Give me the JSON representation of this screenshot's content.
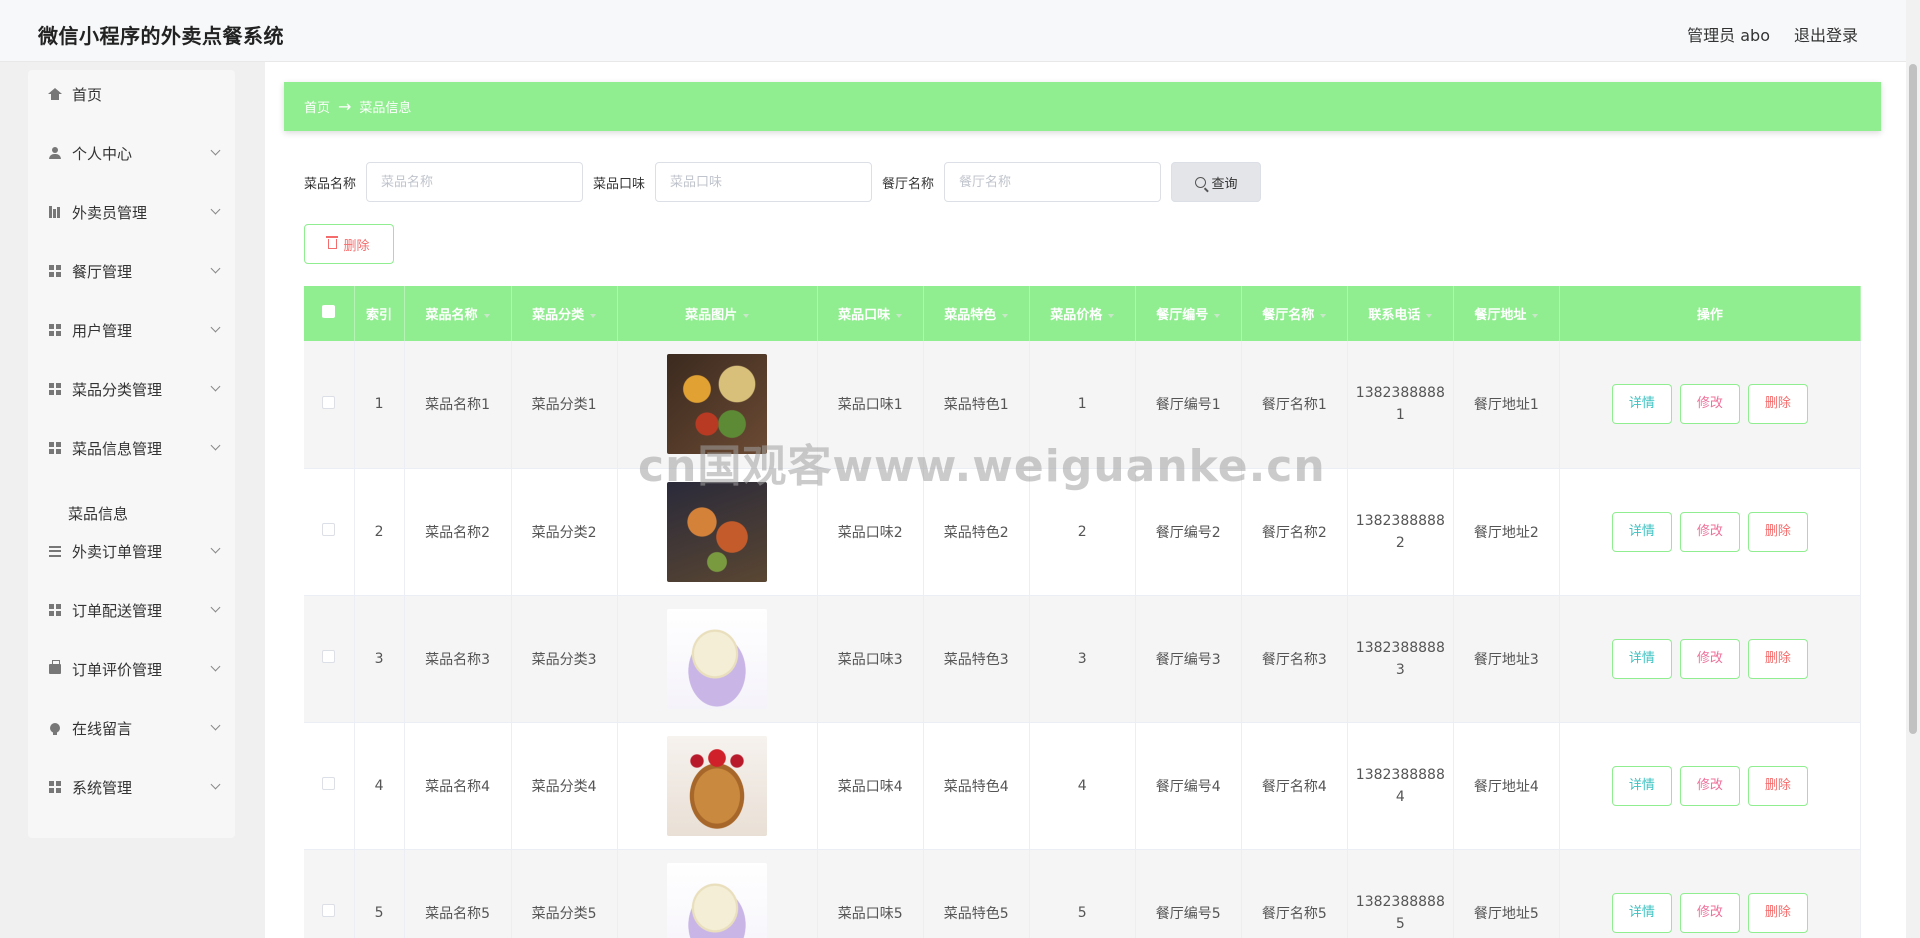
{
  "header": {
    "title": "微信小程序的外卖点餐系统",
    "user": "管理员 abo",
    "logout": "退出登录"
  },
  "sidebar": {
    "items": [
      {
        "label": "首页",
        "icon": "home-icon",
        "arrow": false
      },
      {
        "label": "个人中心",
        "icon": "user-icon",
        "arrow": true
      },
      {
        "label": "外卖员管理",
        "icon": "bar-chart-icon",
        "arrow": true
      },
      {
        "label": "餐厅管理",
        "icon": "grid-icon",
        "arrow": true
      },
      {
        "label": "用户管理",
        "icon": "grid-icon",
        "arrow": true
      },
      {
        "label": "菜品分类管理",
        "icon": "grid-icon",
        "arrow": true
      },
      {
        "label": "菜品信息管理",
        "icon": "grid-icon",
        "arrow": true
      },
      {
        "label": "外卖订单管理",
        "icon": "list-icon",
        "arrow": true
      },
      {
        "label": "订单配送管理",
        "icon": "grid-icon",
        "arrow": true
      },
      {
        "label": "订单评价管理",
        "icon": "bag-icon",
        "arrow": true
      },
      {
        "label": "在线留言",
        "icon": "bulb-icon",
        "arrow": true
      },
      {
        "label": "系统管理",
        "icon": "grid-icon",
        "arrow": true
      }
    ],
    "sub_item": "菜品信息"
  },
  "breadcrumb": {
    "home": "首页",
    "arrow": "→",
    "current": "菜品信息"
  },
  "search": {
    "dish_name_label": "菜品名称",
    "dish_name_placeholder": "菜品名称",
    "taste_label": "菜品口味",
    "taste_placeholder": "菜品口味",
    "restaurant_label": "餐厅名称",
    "restaurant_placeholder": "餐厅名称",
    "query_label": "查询"
  },
  "delete_batch_label": "删除",
  "table": {
    "columns": [
      "索引",
      "菜品名称",
      "菜品分类",
      "菜品图片",
      "菜品口味",
      "菜品特色",
      "菜品价格",
      "餐厅编号",
      "餐厅名称",
      "联系电话",
      "餐厅地址",
      "操作"
    ],
    "rows": [
      {
        "index": "1",
        "name": "菜品名称1",
        "category": "菜品分类1",
        "image": "tacos-dish",
        "taste": "菜品口味1",
        "feature": "菜品特色1",
        "price": "1",
        "rest_no": "餐厅编号1",
        "rest_name": "餐厅名称1",
        "phone_a": "1382388888",
        "phone_b": "1",
        "address": "餐厅地址1"
      },
      {
        "index": "2",
        "name": "菜品名称2",
        "category": "菜品分类2",
        "image": "platter-dish",
        "taste": "菜品口味2",
        "feature": "菜品特色2",
        "price": "2",
        "rest_no": "餐厅编号2",
        "rest_name": "餐厅名称2",
        "phone_a": "1382388888",
        "phone_b": "2",
        "address": "餐厅地址2"
      },
      {
        "index": "3",
        "name": "菜品名称3",
        "category": "菜品分类3",
        "image": "ice-cream-dish",
        "taste": "菜品口味3",
        "feature": "菜品特色3",
        "price": "3",
        "rest_no": "餐厅编号3",
        "rest_name": "餐厅名称3",
        "phone_a": "1382388888",
        "phone_b": "3",
        "address": "餐厅地址3"
      },
      {
        "index": "4",
        "name": "菜品名称4",
        "category": "菜品分类4",
        "image": "pancake-dish",
        "taste": "菜品口味4",
        "feature": "菜品特色4",
        "price": "4",
        "rest_no": "餐厅编号4",
        "rest_name": "餐厅名称4",
        "phone_a": "1382388888",
        "phone_b": "4",
        "address": "餐厅地址4"
      },
      {
        "index": "5",
        "name": "菜品名称5",
        "category": "菜品分类5",
        "image": "ice-cream-dish",
        "taste": "菜品口味5",
        "feature": "菜品特色5",
        "price": "5",
        "rest_no": "餐厅编号5",
        "rest_name": "餐厅名称5",
        "phone_a": "1382388888",
        "phone_b": "5",
        "address": "餐厅地址5"
      }
    ],
    "actions": {
      "detail": "详情",
      "edit": "修改",
      "delete": "删除"
    }
  },
  "watermark": "cn国观客www.weiguanke.cn",
  "colors": {
    "accent": "#90ee90",
    "danger": "#f56c6c",
    "detail": "#3cc2c2",
    "edit": "#f0709a"
  }
}
